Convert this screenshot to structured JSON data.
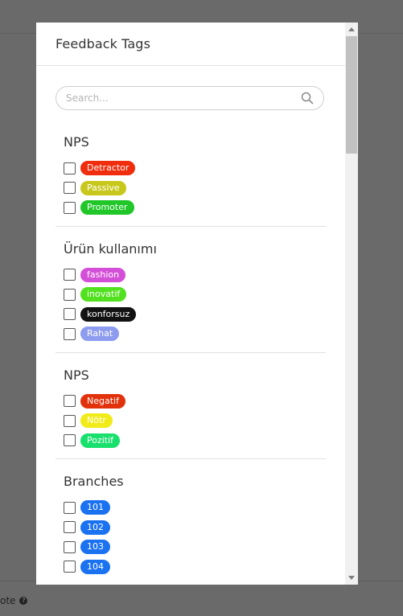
{
  "background": {
    "footer_text": "ote"
  },
  "modal": {
    "title": "Feedback Tags",
    "search": {
      "placeholder": "Search..."
    },
    "groups": [
      {
        "title": "NPS",
        "tags": [
          {
            "label": "Detractor",
            "color": "#f02d0c"
          },
          {
            "label": "Passive",
            "color": "#c8c81c"
          },
          {
            "label": "Promoter",
            "color": "#21c729"
          }
        ]
      },
      {
        "title": "Ürün kullanımı",
        "tags": [
          {
            "label": "fashion",
            "color": "#d44fd8"
          },
          {
            "label": "inovatif",
            "color": "#52e11f"
          },
          {
            "label": "konforsuz",
            "color": "#121212"
          },
          {
            "label": "Rahat",
            "color": "#8d9cee"
          }
        ]
      },
      {
        "title": "NPS",
        "tags": [
          {
            "label": "Negatif",
            "color": "#e2320b"
          },
          {
            "label": "Nötr",
            "color": "#f2eb1a"
          },
          {
            "label": "Pozitif",
            "color": "#18e06c"
          }
        ]
      },
      {
        "title": "Branches",
        "tags": [
          {
            "label": "101",
            "color": "#1a72f1"
          },
          {
            "label": "102",
            "color": "#1a72f1"
          },
          {
            "label": "103",
            "color": "#1a72f1"
          },
          {
            "label": "104",
            "color": "#1a72f1"
          }
        ]
      }
    ]
  }
}
